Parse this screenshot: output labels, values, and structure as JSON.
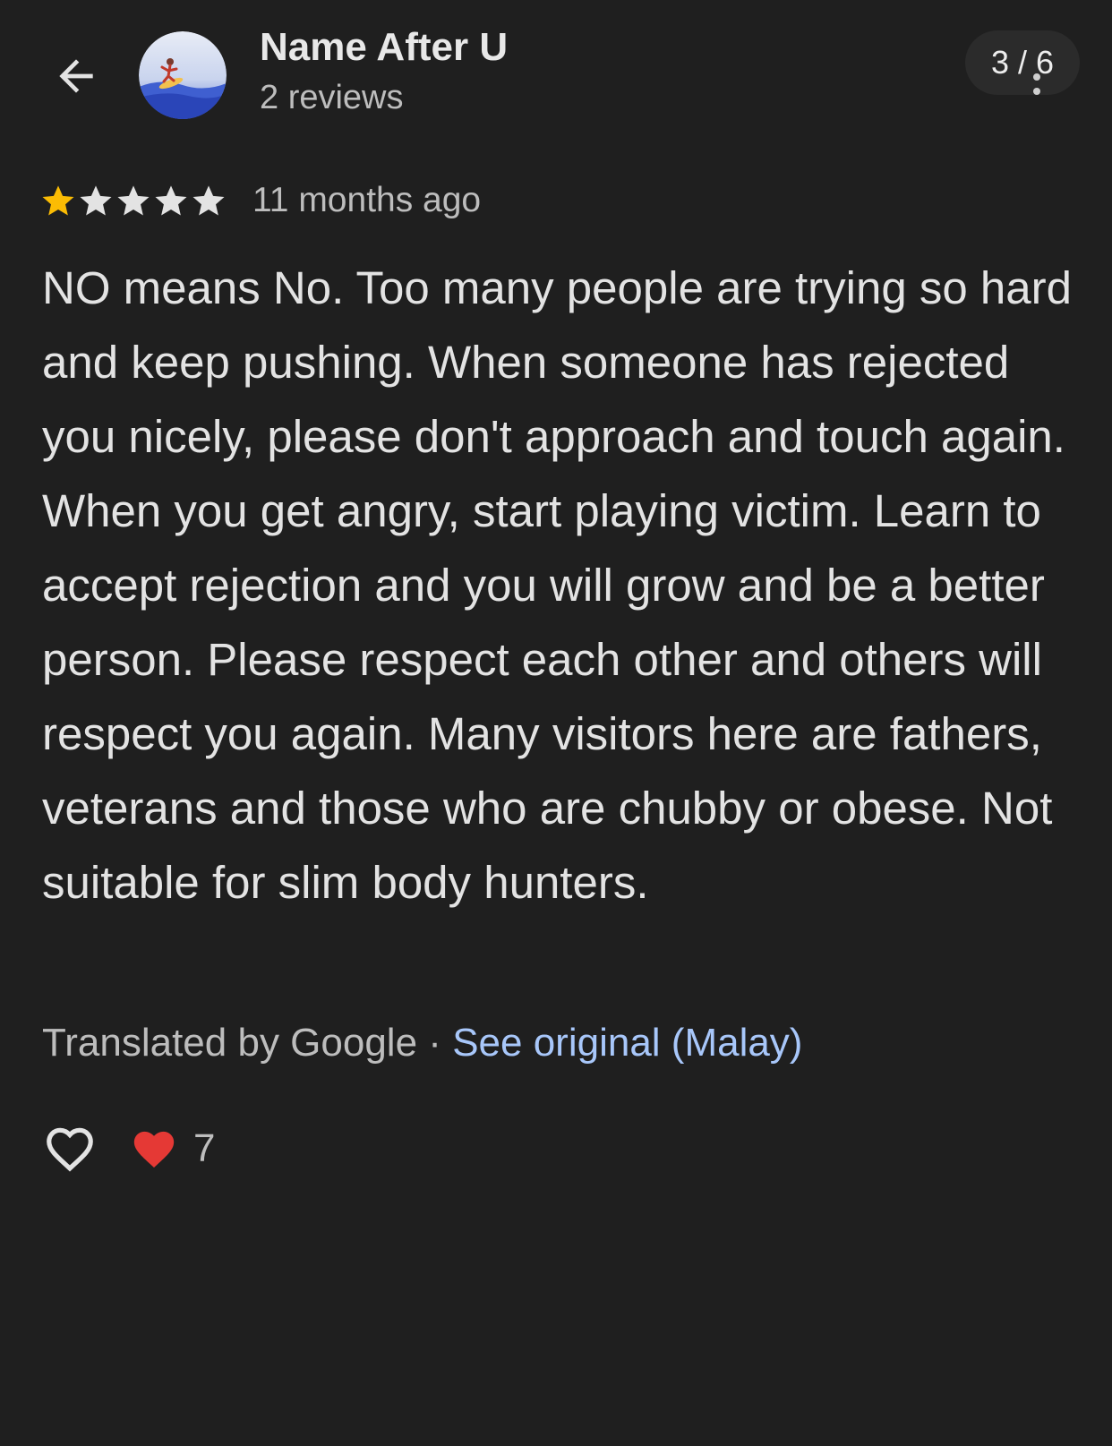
{
  "header": {
    "user_name": "Name After U",
    "review_count": "2 reviews",
    "page_counter": "3 / 6"
  },
  "review": {
    "rating": 1,
    "rating_max": 5,
    "time_ago": "11 months ago",
    "text": "NO means No. Too many people are trying so hard and keep pushing. When someone has rejected you nicely, please don't approach and touch again. When you get angry, start playing victim. Learn to accept rejection and you will grow and be a better person. Please respect each other and others will respect you again. Many visitors here are fathers, veterans and those who are chubby or obese. Not suitable for slim body hunters.",
    "translated_by": "Translated by Google",
    "separator": "·",
    "see_original": "See original (Malay)",
    "like_count": "7"
  },
  "colors": {
    "background": "#1f1f1f",
    "star_filled": "#fbbc04",
    "star_empty": "#e3e3e3",
    "link": "#a8c7fa",
    "heart_reaction": "#e53935"
  },
  "icons": {
    "back": "arrow-back-icon",
    "more": "more-vert-icon",
    "like": "heart-outline-icon",
    "reaction": "red-heart-icon"
  }
}
